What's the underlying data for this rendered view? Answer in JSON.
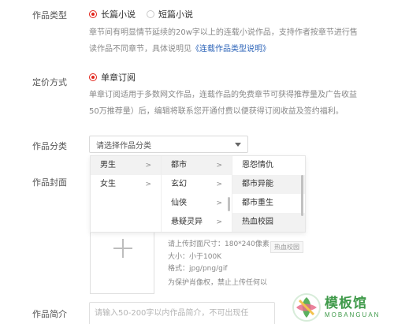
{
  "work_type": {
    "label": "作品类型",
    "options": [
      {
        "label": "长篇小说",
        "checked": true
      },
      {
        "label": "短篇小说",
        "checked": false
      }
    ],
    "desc_line1": "章节间有明显情节延续的20w字以上的连载小说作品，支持作者按章节进行售",
    "desc_line2_prefix": "读作品不同章节，具体说明见",
    "desc_link": "《连载作品类型说明》"
  },
  "pricing": {
    "label": "定价方式",
    "option": "单章订阅",
    "desc_line1": "单章订阅适用于多数网文作品，连载作品的免费章节可获得推荐量及广告收益",
    "desc_line2": "50万推荐量）后，编辑将联系您开通付费以便获得订阅收益及签约福利。"
  },
  "category": {
    "label": "作品分类",
    "placeholder": "请选择作品分类",
    "col1": [
      {
        "label": "男生",
        "arrow": ">"
      },
      {
        "label": "女生",
        "arrow": ">"
      }
    ],
    "col2": [
      {
        "label": "都市",
        "arrow": ">"
      },
      {
        "label": "玄幻",
        "arrow": ">"
      },
      {
        "label": "仙侠",
        "arrow": ">"
      },
      {
        "label": "悬疑灵异",
        "arrow": ">"
      }
    ],
    "col3": [
      "恩怨情仇",
      "都市异能",
      "都市重生",
      "热血校园"
    ],
    "tooltip": "热血校园"
  },
  "cover": {
    "label": "作品封面",
    "size_text": "请上传封面尺寸：180*240像素",
    "max_text": "大小：小于100K",
    "format_text": "格式：jpg/png/gif",
    "notice_text": "为保护肖像权，禁止上传任何以"
  },
  "intro": {
    "label": "作品简介",
    "placeholder": "请输入50-200字以内作品简介，不可出现任"
  },
  "watermark": {
    "cn": "模板馆",
    "en": "MOBANGUAN"
  },
  "colors": {
    "accent": "#e2231a",
    "link": "#2b63b8",
    "watermark": "#3f9a4a"
  }
}
